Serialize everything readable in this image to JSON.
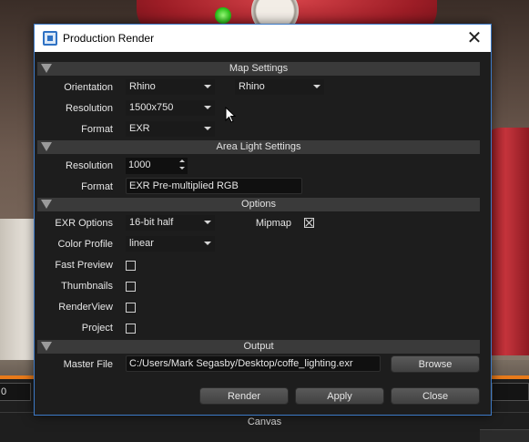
{
  "dialog": {
    "title": "Production Render",
    "close_glyph": "✕"
  },
  "map_settings": {
    "header": "Map Settings",
    "orientation_label": "Orientation",
    "orientation_value": "Rhino",
    "orientation_value2": "Rhino",
    "resolution_label": "Resolution",
    "resolution_value": "1500x750",
    "format_label": "Format",
    "format_value": "EXR"
  },
  "area_light": {
    "header": "Area Light Settings",
    "resolution_label": "Resolution",
    "resolution_value": "1000",
    "format_label": "Format",
    "format_value": "EXR Pre-multiplied RGB"
  },
  "options": {
    "header": "Options",
    "exr_label": "EXR Options",
    "exr_value": "16-bit half",
    "mipmap_label": "Mipmap",
    "mipmap_checked": true,
    "color_profile_label": "Color Profile",
    "color_profile_value": "linear",
    "fast_preview_label": "Fast Preview",
    "thumbnails_label": "Thumbnails",
    "renderview_label": "RenderView",
    "project_label": "Project"
  },
  "output": {
    "header": "Output",
    "master_file_label": "Master File",
    "master_file_value": "C:/Users/Mark Segasby/Desktop/coffe_lighting.exr",
    "browse_label": "Browse"
  },
  "buttons": {
    "render": "Render",
    "apply": "Apply",
    "close": "Close"
  },
  "background": {
    "zero_value": "0",
    "canvas_label": "Canvas"
  }
}
